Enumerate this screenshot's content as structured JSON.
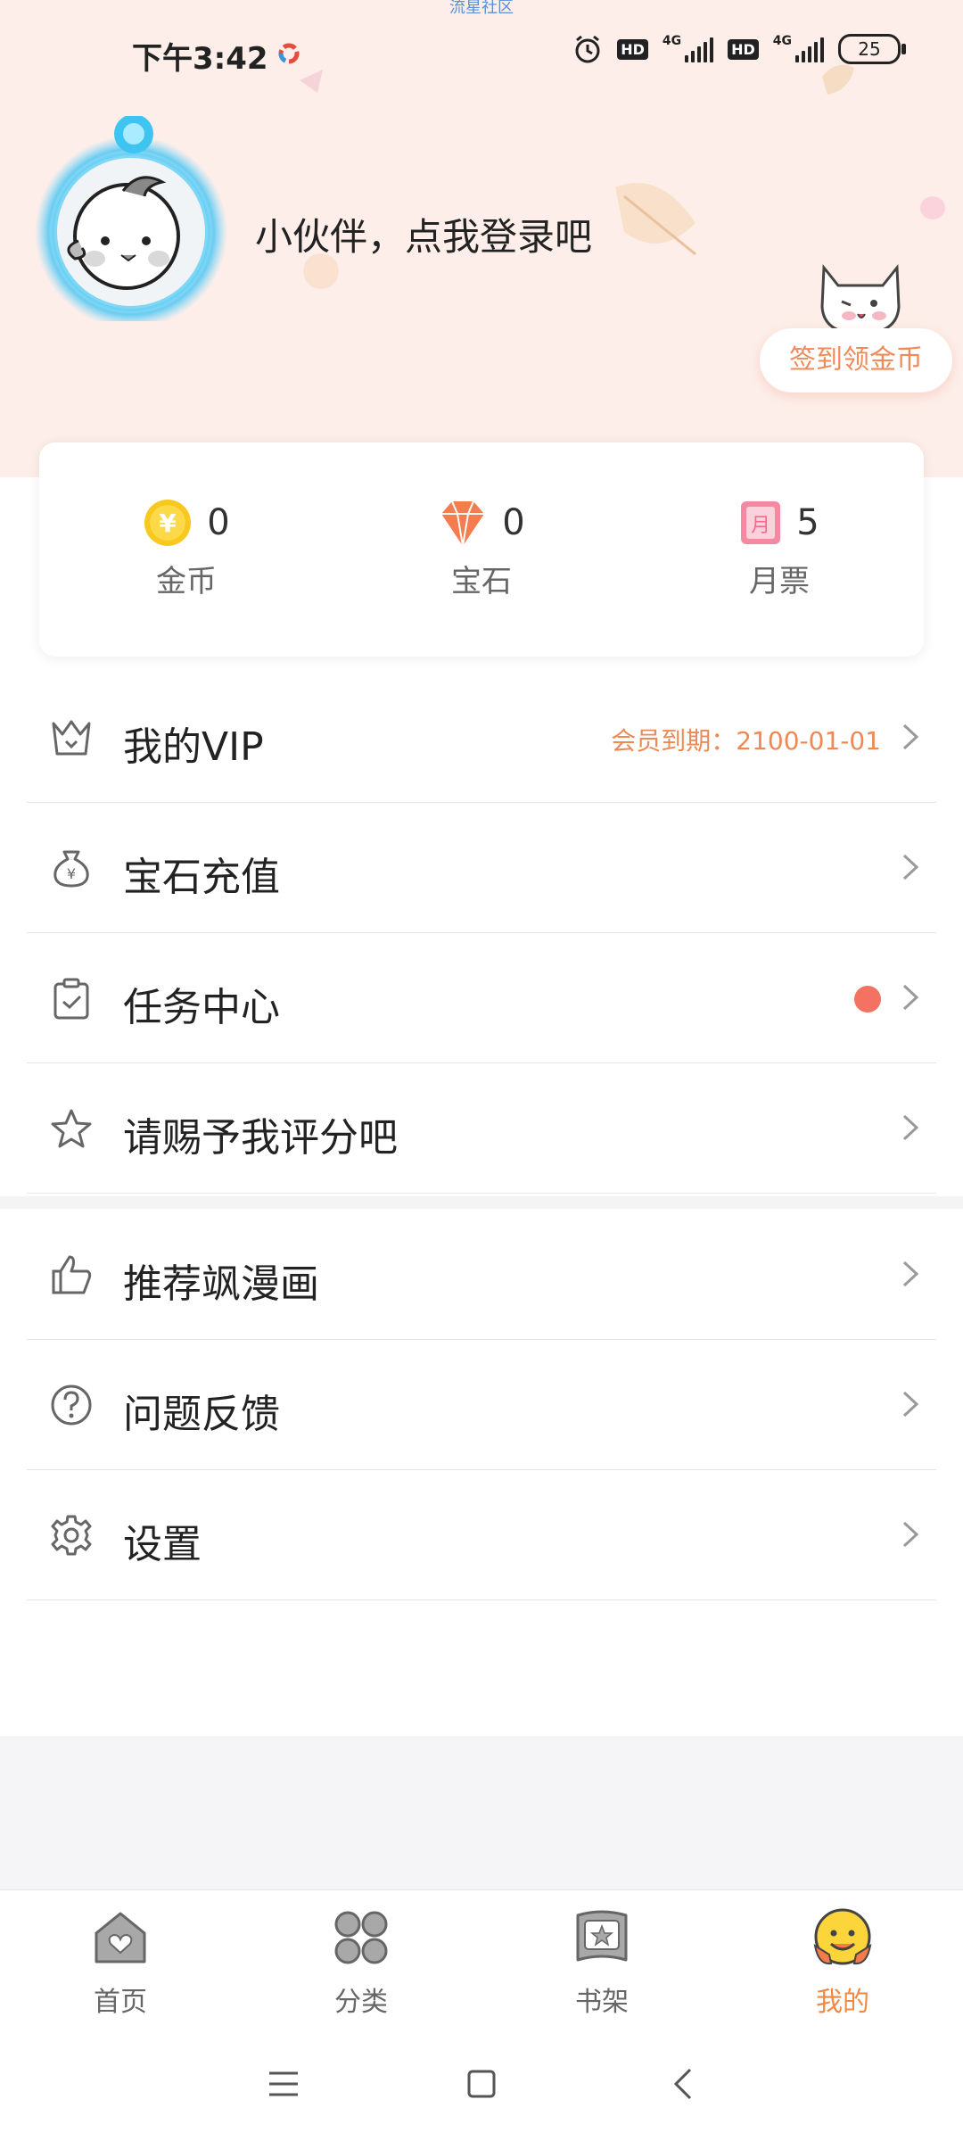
{
  "status_bar": {
    "watermark": "流星社区",
    "time": "下午3:42",
    "hd1": "HD",
    "net1": "4G",
    "hd2": "HD",
    "net2": "4G",
    "battery": "25"
  },
  "profile": {
    "login_prompt": "小伙伴，点我登录吧",
    "checkin_label": "签到领金币"
  },
  "stats": [
    {
      "icon": "gold-coin-icon",
      "value": "0",
      "label": "金币"
    },
    {
      "icon": "gem-icon",
      "value": "0",
      "label": "宝石"
    },
    {
      "icon": "monthly-ticket-icon",
      "value": "5",
      "label": "月票"
    }
  ],
  "menu": {
    "vip": {
      "label": "我的VIP",
      "expire": "会员到期：2100-01-01"
    },
    "gem_recharge": {
      "label": "宝石充值"
    },
    "task_center": {
      "label": "任务中心"
    },
    "rate": {
      "label": "请赐予我评分吧"
    },
    "recommend": {
      "label": "推荐飒漫画"
    },
    "feedback": {
      "label": "问题反馈"
    },
    "settings": {
      "label": "设置"
    }
  },
  "tabs": [
    {
      "label": "首页",
      "icon": "home-icon"
    },
    {
      "label": "分类",
      "icon": "category-icon"
    },
    {
      "label": "书架",
      "icon": "bookshelf-icon"
    },
    {
      "label": "我的",
      "icon": "profile-icon",
      "active": true
    }
  ],
  "colors": {
    "accent": "#ef8a45",
    "header_bg": "#fdeee9",
    "red_dot": "#f47262"
  }
}
